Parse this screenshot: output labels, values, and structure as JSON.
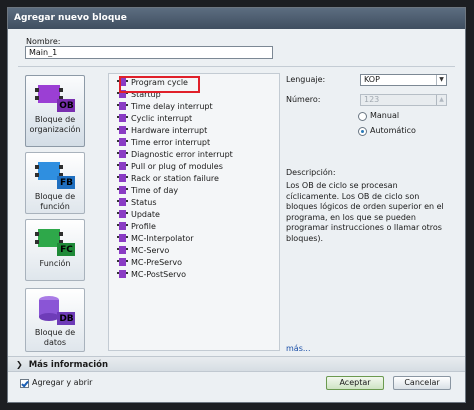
{
  "dialog": {
    "title": "Agregar nuevo bloque"
  },
  "name": {
    "label": "Nombre:",
    "value": "Main_1"
  },
  "block_types": [
    {
      "label": "Bloque de organización",
      "tag": "OB",
      "icon": "ob-block-icon",
      "color": "#9b3fd4"
    },
    {
      "label": "Bloque de función",
      "tag": "FB",
      "icon": "fb-block-icon",
      "color": "#2f8fe0"
    },
    {
      "label": "Función",
      "tag": "FC",
      "icon": "fc-block-icon",
      "color": "#2ea84a"
    },
    {
      "label": "Bloque de datos",
      "tag": "DB",
      "icon": "db-block-icon",
      "color": "#8a55d6"
    }
  ],
  "ob_list": {
    "selected": "Program cycle",
    "items": [
      "Program cycle",
      "Startup",
      "Time delay interrupt",
      "Cyclic interrupt",
      "Hardware interrupt",
      "Time error interrupt",
      "Diagnostic error interrupt",
      "Pull or plug of modules",
      "Rack or station failure",
      "Time of day",
      "Status",
      "Update",
      "Profile",
      "MC-Interpolator",
      "MC-Servo",
      "MC-PreServo",
      "MC-PostServo"
    ]
  },
  "properties": {
    "language_label": "Lenguaje:",
    "language_value": "KOP",
    "number_label": "Número:",
    "number_value": "123",
    "manual_label": "Manual",
    "auto_label": "Automático",
    "numbering_mode": "Automático"
  },
  "description": {
    "title": "Descripción:",
    "text": "Los OB de ciclo se procesan cíclicamente. Los OB de ciclo son bloques lógicos de orden superior en el programa, en los que se pueden programar instrucciones o llamar otros bloques).",
    "more_link": "más..."
  },
  "more_info": {
    "label": "Más información"
  },
  "footer": {
    "add_open_label": "Agregar y abrir",
    "add_open_checked": true,
    "accept_label": "Aceptar",
    "cancel_label": "Cancelar"
  },
  "colors": {
    "highlight": "#e0202a",
    "ob_item_icon": "#8a3cc4",
    "title_bar": "#4a5a6c"
  }
}
